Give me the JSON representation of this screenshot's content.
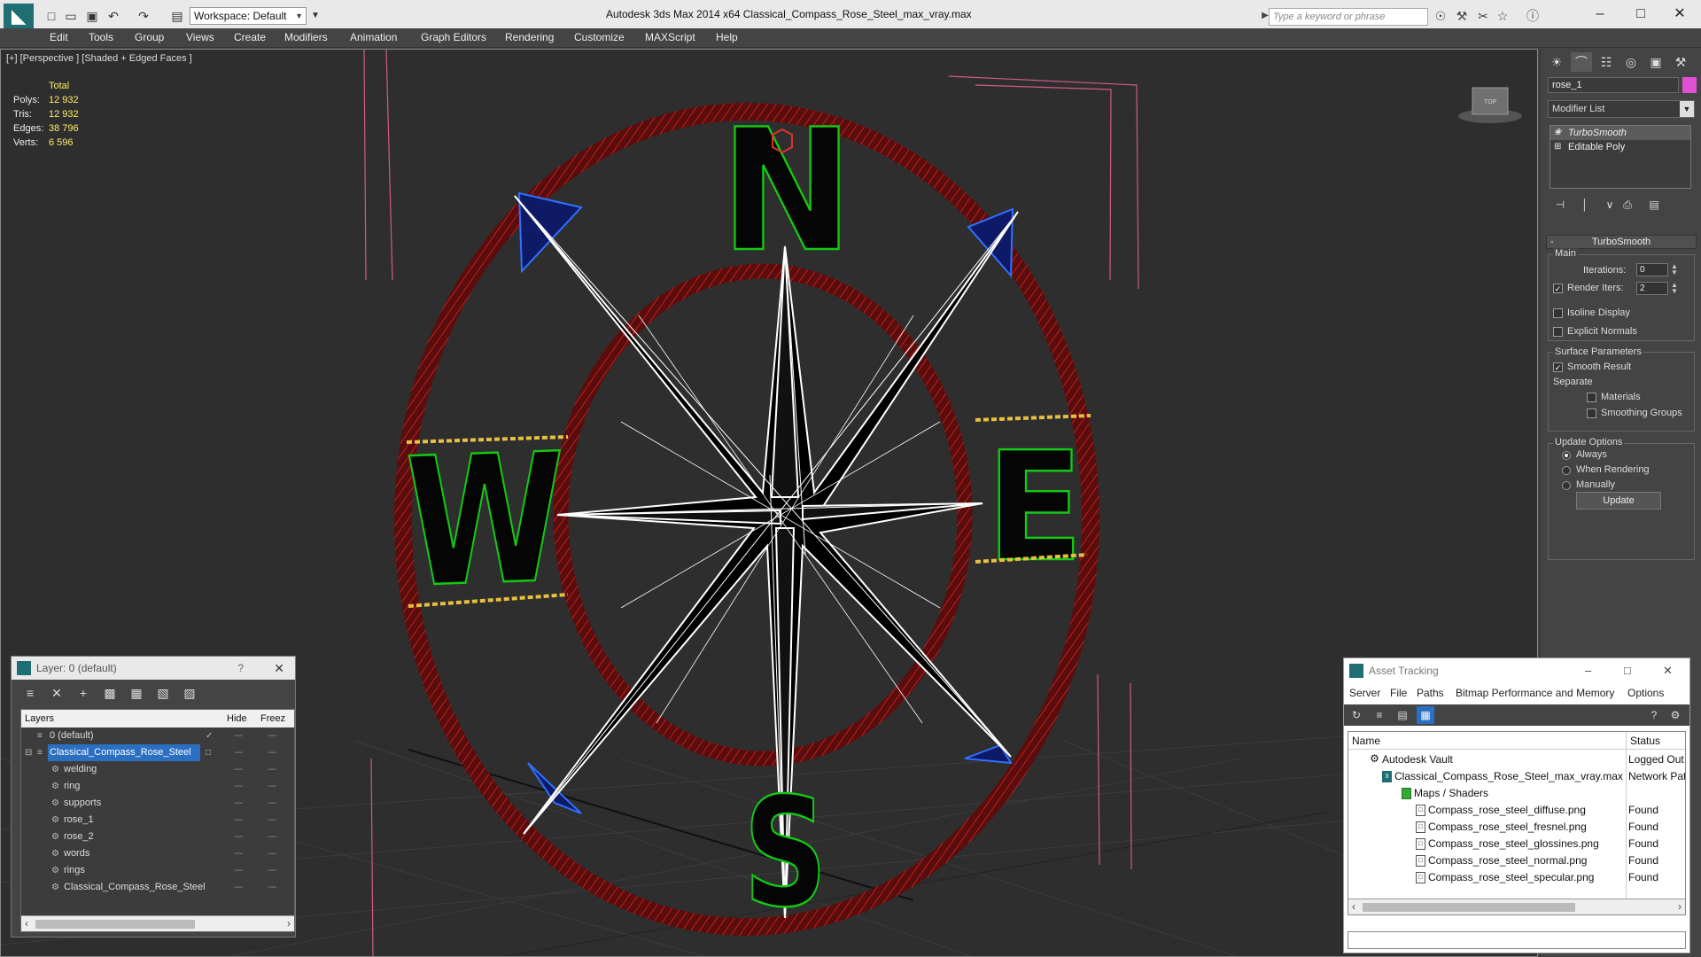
{
  "titlebar": {
    "app_title": "Autodesk 3ds Max  2014 x64      Classical_Compass_Rose_Steel_max_vray.max",
    "workspace": "Workspace: Default",
    "search_placeholder": "Type a keyword or phrase"
  },
  "menu": [
    "Edit",
    "Tools",
    "Group",
    "Views",
    "Create",
    "Modifiers",
    "Animation",
    "Graph Editors",
    "Rendering",
    "Customize",
    "MAXScript",
    "Help"
  ],
  "viewport": {
    "label": "[+] [Perspective ] [Shaded + Edged Faces ]",
    "stats": {
      "header": "Total",
      "polys_label": "Polys:",
      "polys": "12 932",
      "tris_label": "Tris:",
      "tris": "12 932",
      "edges_label": "Edges:",
      "edges": "38 796",
      "verts_label": "Verts:",
      "verts": "6 596"
    },
    "letters": {
      "north": "N",
      "south": "S",
      "east": "E",
      "west": "W"
    },
    "viewcube_label": "TOP",
    "colors": {
      "background": "#2e2e2e",
      "ring": "#8a1a1a",
      "letters": "#0a8a0a",
      "star": "#000000",
      "wire": "#ffffff",
      "accent_blue": "#2050ff"
    }
  },
  "command_panel": {
    "object_name": "rose_1",
    "object_color": "#e050d0",
    "modifier_list": "Modifier List",
    "stack": [
      "TurboSmooth",
      "Editable Poly"
    ],
    "rollout_title": "TurboSmooth",
    "main_label": "Main",
    "iterations_label": "Iterations:",
    "iterations": "0",
    "render_iters_label": "Render Iters:",
    "render_iters": "2",
    "isoline_label": "Isoline Display",
    "explicit_normals_label": "Explicit Normals",
    "surface_label": "Surface Parameters",
    "smooth_result_label": "Smooth Result",
    "separate_label": "Separate",
    "materials_label": "Materials",
    "smoothing_groups_label": "Smoothing Groups",
    "update_options_label": "Update Options",
    "always_label": "Always",
    "when_rendering_label": "When Rendering",
    "manually_label": "Manually",
    "update_button": "Update"
  },
  "layer_window": {
    "title": "Layer: 0 (default)",
    "help": "?",
    "col_layers": "Layers",
    "col_hide": "Hide",
    "col_freeze": "Freez",
    "rows": [
      {
        "name": "0 (default)"
      },
      {
        "name": "Classical_Compass_Rose_Steel"
      },
      {
        "name": "welding"
      },
      {
        "name": "ring"
      },
      {
        "name": "supports"
      },
      {
        "name": "rose_1"
      },
      {
        "name": "rose_2"
      },
      {
        "name": "words"
      },
      {
        "name": "rings"
      },
      {
        "name": "Classical_Compass_Rose_Steel"
      }
    ]
  },
  "asset_window": {
    "title": "Asset Tracking",
    "menu": [
      "Server",
      "File",
      "Paths",
      "Bitmap Performance and Memory",
      "Options"
    ],
    "col_name": "Name",
    "col_status": "Status",
    "rows": [
      {
        "name": "Autodesk Vault",
        "status": "Logged Out"
      },
      {
        "name": "Classical_Compass_Rose_Steel_max_vray.max",
        "status": "Network Pat"
      },
      {
        "name": "Maps / Shaders",
        "status": ""
      },
      {
        "name": "Compass_rose_steel_diffuse.png",
        "status": "Found"
      },
      {
        "name": "Compass_rose_steel_fresnel.png",
        "status": "Found"
      },
      {
        "name": "Compass_rose_steel_glossines.png",
        "status": "Found"
      },
      {
        "name": "Compass_rose_steel_normal.png",
        "status": "Found"
      },
      {
        "name": "Compass_rose_steel_specular.png",
        "status": "Found"
      }
    ]
  }
}
